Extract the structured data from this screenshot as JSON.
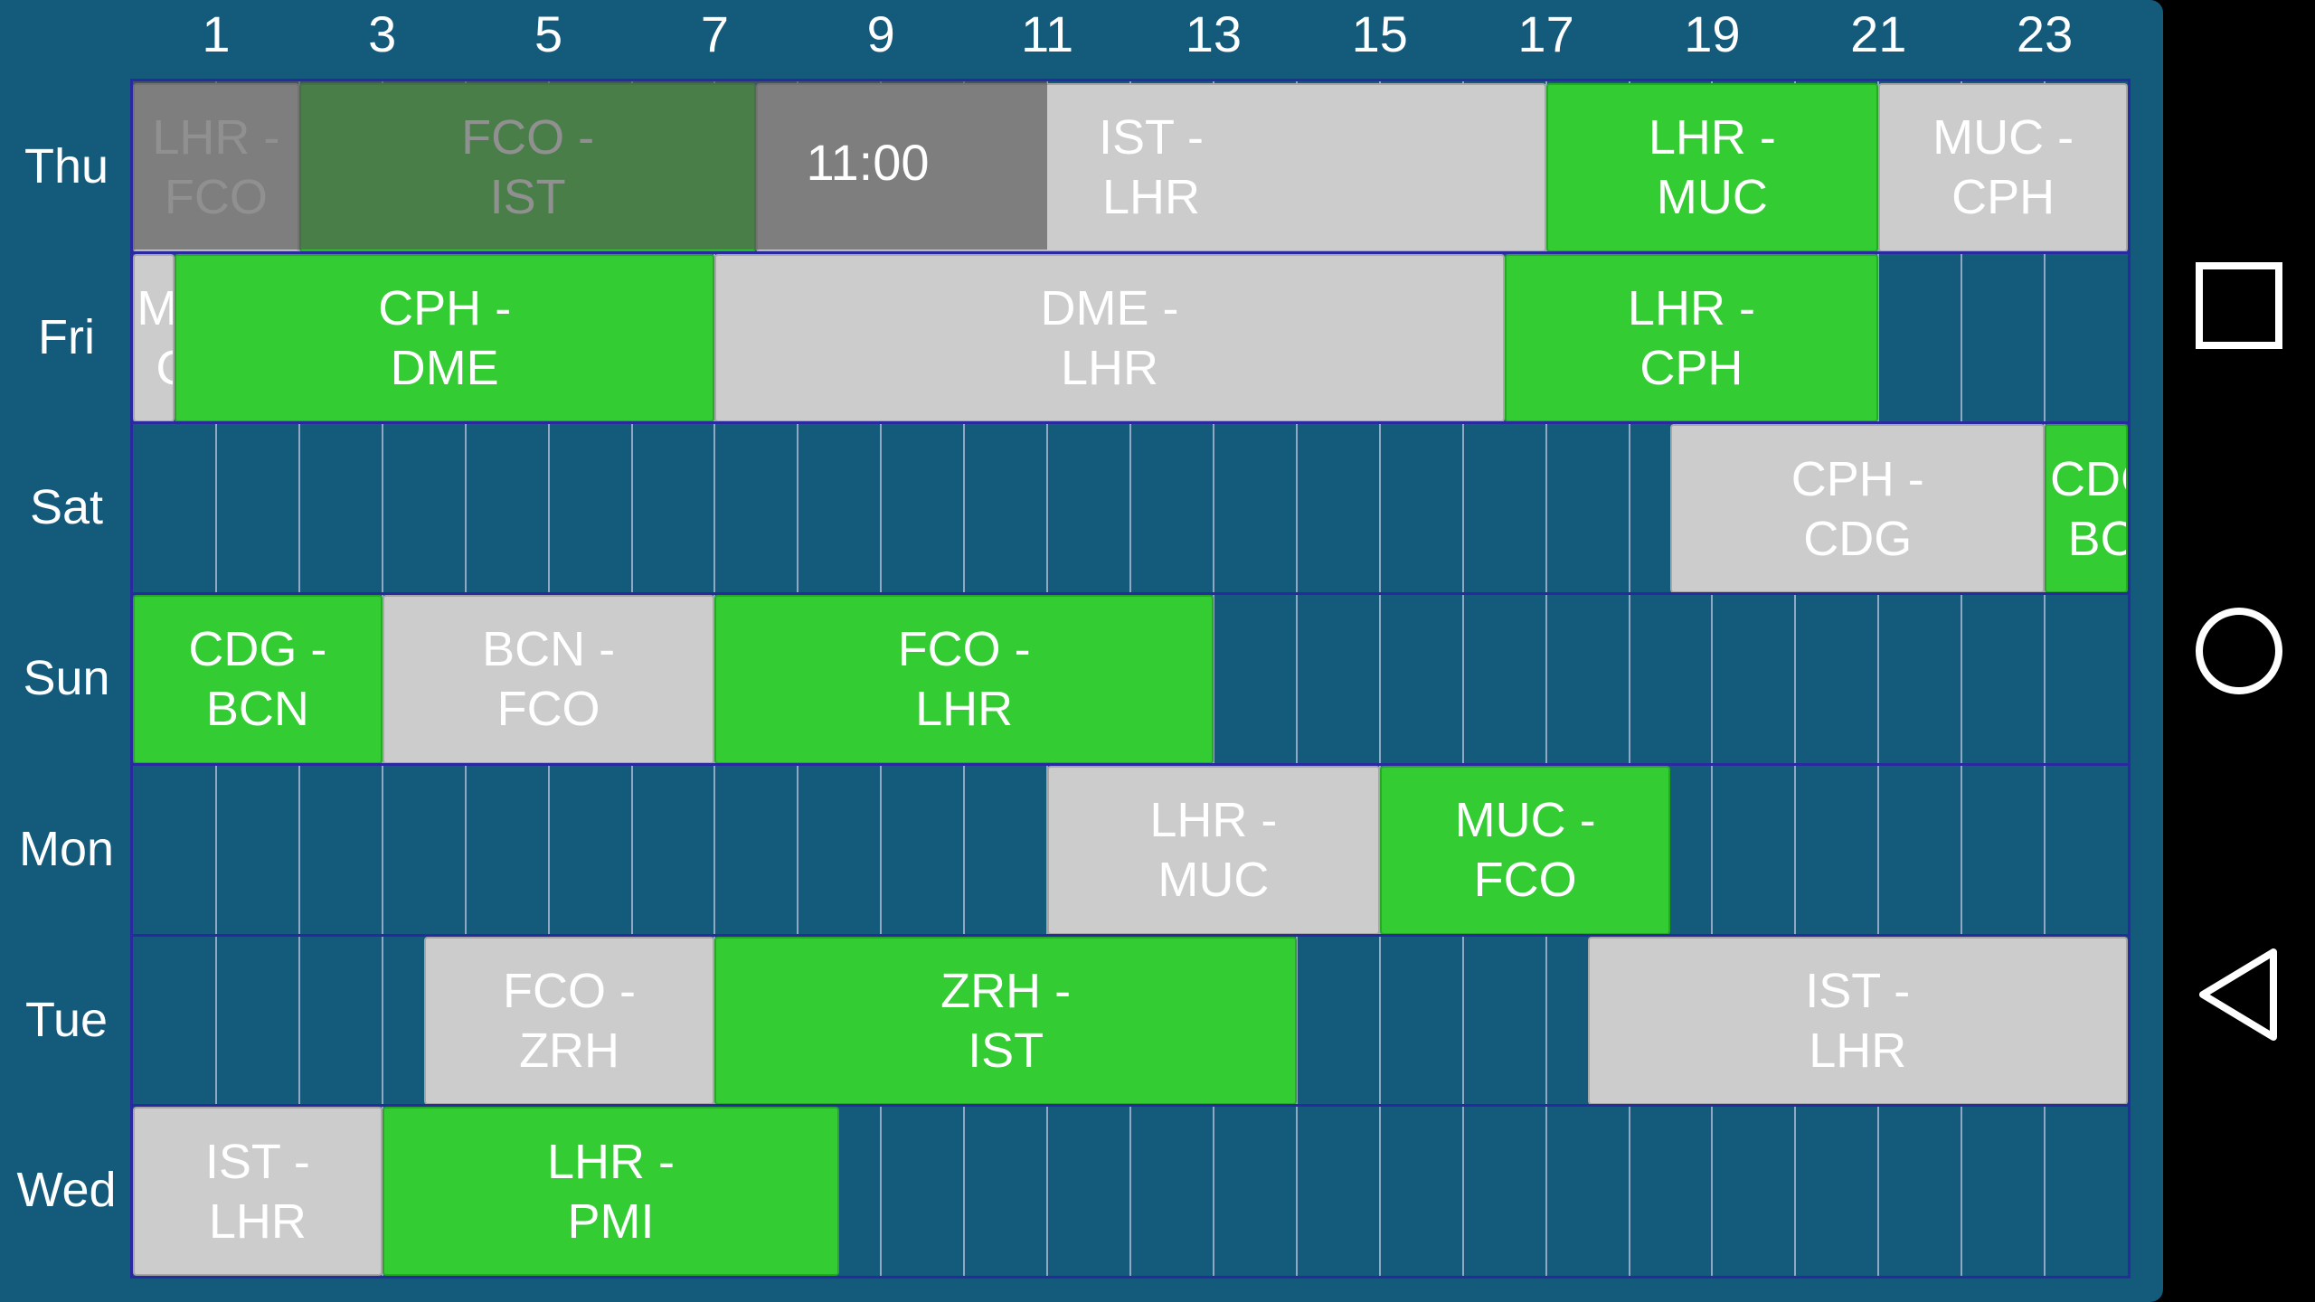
{
  "header": {
    "hour_labels": [
      "1",
      "3",
      "5",
      "7",
      "9",
      "11",
      "13",
      "15",
      "17",
      "19",
      "21",
      "23"
    ]
  },
  "days": [
    {
      "label": "Thu",
      "events": [
        {
          "from": "LHR",
          "to": "FCO",
          "start": 0,
          "end": 2,
          "color": "gray"
        },
        {
          "from": "FCO",
          "to": "IST",
          "start": 2,
          "end": 7.5,
          "color": "green"
        },
        {
          "from": "IST",
          "to": "LHR",
          "start": 7.5,
          "end": 17,
          "color": "gray"
        },
        {
          "from": "LHR",
          "to": "MUC",
          "start": 17,
          "end": 21,
          "color": "green"
        },
        {
          "from": "MUC",
          "to": "CPH",
          "start": 21,
          "end": 24,
          "color": "gray"
        }
      ]
    },
    {
      "label": "Fri",
      "events": [
        {
          "from": "MUC",
          "to": "CPH",
          "start": 0,
          "end": 0.5,
          "color": "gray",
          "clipped": true
        },
        {
          "from": "CPH",
          "to": "DME",
          "start": 0.5,
          "end": 7,
          "color": "green"
        },
        {
          "from": "DME",
          "to": "LHR",
          "start": 7,
          "end": 16.5,
          "color": "gray"
        },
        {
          "from": "LHR",
          "to": "CPH",
          "start": 16.5,
          "end": 21,
          "color": "green"
        }
      ]
    },
    {
      "label": "Sat",
      "events": [
        {
          "from": "CPH",
          "to": "CDG",
          "start": 18.5,
          "end": 23,
          "color": "gray"
        },
        {
          "from": "CDG",
          "to": "BCN",
          "start": 23,
          "end": 24,
          "color": "green",
          "clipped": true
        }
      ]
    },
    {
      "label": "Sun",
      "events": [
        {
          "from": "CDG",
          "to": "BCN",
          "start": 0,
          "end": 3,
          "color": "green"
        },
        {
          "from": "BCN",
          "to": "FCO",
          "start": 3,
          "end": 7,
          "color": "gray"
        },
        {
          "from": "FCO",
          "to": "LHR",
          "start": 7,
          "end": 13,
          "color": "green"
        }
      ]
    },
    {
      "label": "Mon",
      "events": [
        {
          "from": "LHR",
          "to": "MUC",
          "start": 11,
          "end": 15,
          "color": "gray"
        },
        {
          "from": "MUC",
          "to": "FCO",
          "start": 15,
          "end": 18.5,
          "color": "green"
        }
      ]
    },
    {
      "label": "Tue",
      "events": [
        {
          "from": "FCO",
          "to": "ZRH",
          "start": 3.5,
          "end": 7,
          "color": "gray"
        },
        {
          "from": "ZRH",
          "to": "IST",
          "start": 7,
          "end": 14,
          "color": "green"
        },
        {
          "from": "IST",
          "to": "LHR",
          "start": 17.5,
          "end": 24,
          "color": "gray"
        }
      ]
    },
    {
      "label": "Wed",
      "events": [
        {
          "from": "IST",
          "to": "LHR",
          "start": 0,
          "end": 3,
          "color": "gray"
        },
        {
          "from": "LHR",
          "to": "PMI",
          "start": 3,
          "end": 8.5,
          "color": "green"
        }
      ]
    }
  ],
  "now": {
    "label": "11:00",
    "hour": 11
  },
  "colors": {
    "green": "#33cc33",
    "gray": "#cccccc",
    "background": "#135a7b",
    "grid_border": "#2a2aa0"
  },
  "navbar": {
    "buttons": [
      "recents-icon",
      "home-icon",
      "back-icon"
    ]
  }
}
